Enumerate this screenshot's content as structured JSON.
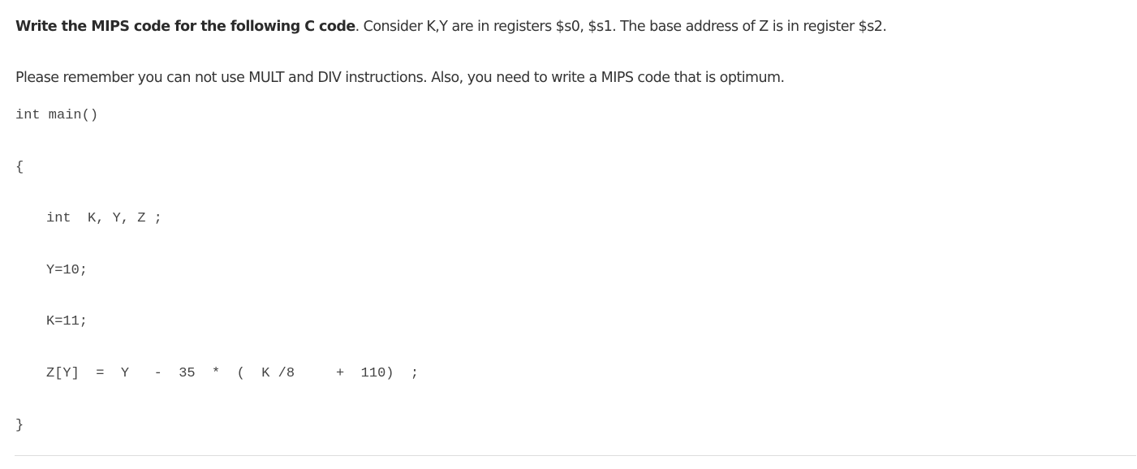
{
  "question": {
    "instruction_bold": "Write the MIPS code for the following C code",
    "instruction_rest": ". Consider K,Y are in registers $s0, $s1. The base address of Z is in register $s2.",
    "note": "Please remember you can not use MULT and DIV instructions. Also, you need to write a MIPS code that is optimum."
  },
  "code": {
    "lines": [
      "int main()",
      "{",
      "int  K, Y, Z ;",
      "Y=10;",
      "K=11;",
      "Z[Y]  =  Y   -  35  *  (  K /8     +  110)  ;",
      "}"
    ]
  }
}
